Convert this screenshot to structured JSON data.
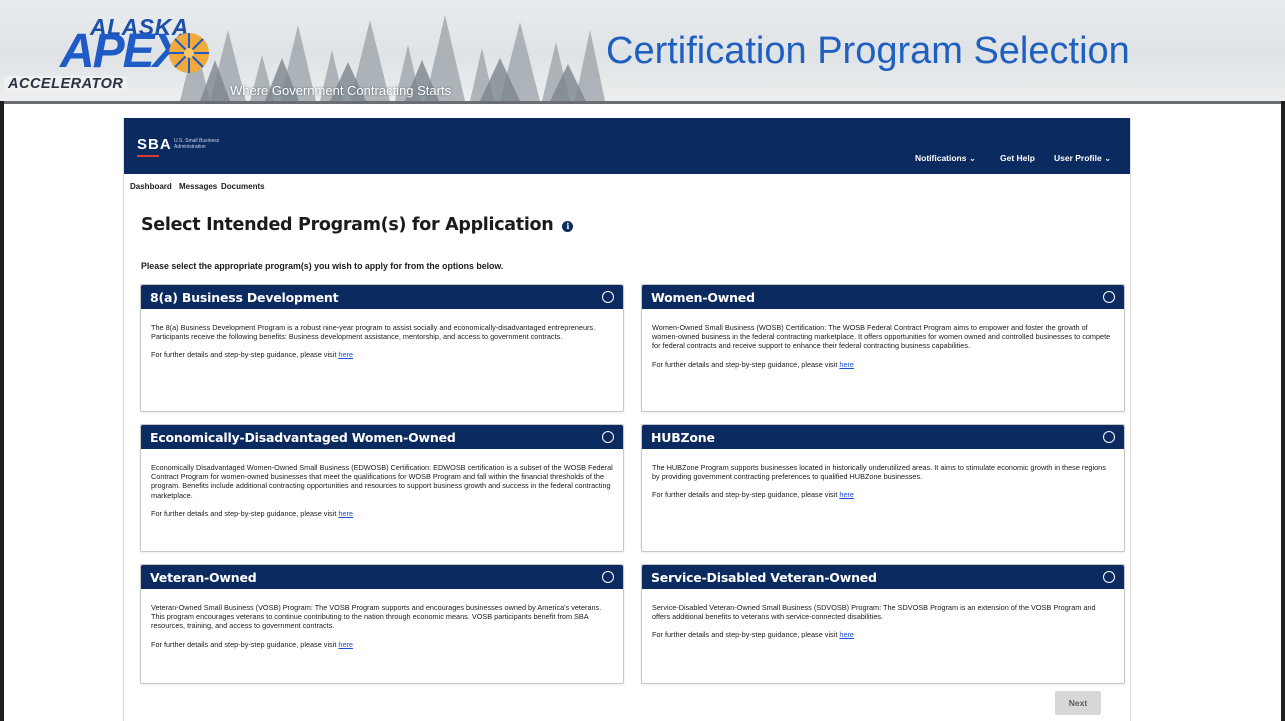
{
  "slide": {
    "logo": {
      "line1": "ALASKA",
      "line2": "APEX",
      "line3": "ACCELERATOR"
    },
    "tagline": "Where Government Contracting Starts",
    "title": "Certification Program Selection"
  },
  "sba": {
    "logo_text": "SBA",
    "agency_name": "U.S. Small Business Administration",
    "header_nav": {
      "notifications": "Notifications ⌄",
      "get_help": "Get Help",
      "user_profile": "User Profile ⌄"
    },
    "subnav": {
      "dashboard": "Dashboard",
      "messages": "Messages",
      "documents": "Documents"
    },
    "heading": "Select Intended Program(s) for Application",
    "info_glyph": "i",
    "instructions": "Please select the appropriate program(s) you wish to apply for from the options below.",
    "link_prefix": "For further details and step-by-step guidance, please visit",
    "link_text": "here",
    "next_label": "Next",
    "programs": [
      {
        "title": "8(a) Business Development",
        "description": "The 8(a) Business Development Program is a robust nine-year program to assist socially and economically-disadvantaged entrepreneurs. Participants receive the following benefits: Business development assistance, mentorship, and access to government contracts."
      },
      {
        "title": "Women-Owned",
        "description": "Women-Owned Small Business (WOSB) Certification: The WOSB Federal Contract Program aims to empower and foster the growth of women-owned business in the federal contracting marketplace. It offers opportunities for women owned and controlled businesses to compete for federal contracts and receive support to enhance their federal contracting business capabilities."
      },
      {
        "title": "Economically-Disadvantaged Women-Owned",
        "description": "Economically Disadvantaged Women-Owned Small Business (EDWOSB) Certification: EDWOSB certification is a subset of the WOSB Federal Contract Program for women-owned businesses that meet the qualifications for WOSB Program and fall within the financial thresholds of the program. Benefits include additional contracting opportunities and resources to support business growth and success in the federal contracting marketplace."
      },
      {
        "title": "HUBZone",
        "description": "The HUBZone Program supports businesses located in historically underutilized areas. It aims to stimulate economic growth in these regions by providing government contracting preferences to qualified HUBZone businesses."
      },
      {
        "title": "Veteran-Owned",
        "description": "Veteran-Owned Small Business (VOSB) Program: The VOSB Program supports and encourages businesses owned by America's veterans. This program encourages veterans to continue contributing to the nation through economic means. VOSB participants benefit from SBA resources, training, and access to government contracts."
      },
      {
        "title": "Service-Disabled Veteran-Owned",
        "description": "Service-Disabled Veteran-Owned Small Business (SDVOSB) Program: The SDVOSB Program is an extension of the VOSB Program and offers additional benefits to veterans with service-connected disabilities."
      }
    ]
  },
  "colors": {
    "sba_navy": "#0b2a5f",
    "slide_title_blue": "#1f5fbf",
    "link_blue": "#1a4fd6",
    "sba_red": "#d83933"
  }
}
